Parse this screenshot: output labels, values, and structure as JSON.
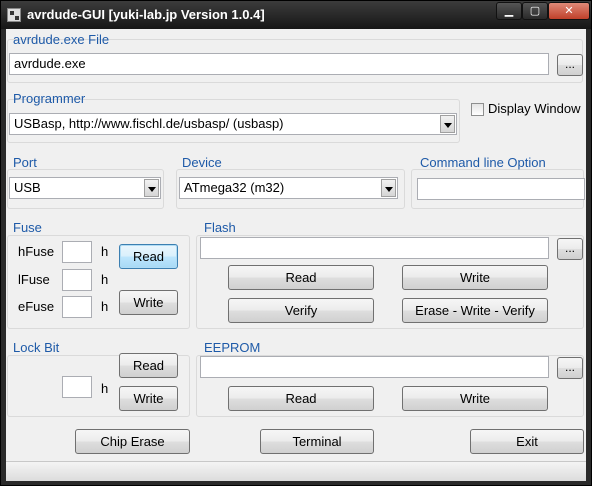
{
  "window": {
    "title": "avrdude-GUI [yuki-lab.jp Version 1.0.4]",
    "minimize_glyph": "▁",
    "maximize_glyph": "▢",
    "close_glyph": "✕"
  },
  "avrdude_file": {
    "legend": "avrdude.exe File",
    "value": "avrdude.exe",
    "browse_label": "..."
  },
  "programmer": {
    "legend": "Programmer",
    "selected": "USBasp, http://www.fischl.de/usbasp/ (usbasp)",
    "display_window_label": "Display Window",
    "display_window_checked": false
  },
  "port": {
    "legend": "Port",
    "selected": "USB"
  },
  "device": {
    "legend": "Device",
    "selected": "ATmega32 (m32)"
  },
  "command_line": {
    "legend": "Command line Option",
    "value": ""
  },
  "fuse": {
    "legend": "Fuse",
    "hfuse_label": "hFuse",
    "lfuse_label": "lFuse",
    "efuse_label": "eFuse",
    "unit": "h",
    "hfuse_value": "",
    "lfuse_value": "",
    "efuse_value": "",
    "read_label": "Read",
    "write_label": "Write"
  },
  "flash": {
    "legend": "Flash",
    "file_value": "",
    "browse_label": "...",
    "read_label": "Read",
    "write_label": "Write",
    "verify_label": "Verify",
    "erase_write_verify_label": "Erase - Write - Verify"
  },
  "lock_bit": {
    "legend": "Lock Bit",
    "unit": "h",
    "value": "",
    "read_label": "Read",
    "write_label": "Write"
  },
  "eeprom": {
    "legend": "EEPROM",
    "file_value": "",
    "browse_label": "...",
    "read_label": "Read",
    "write_label": "Write"
  },
  "bottom": {
    "chip_erase_label": "Chip Erase",
    "terminal_label": "Terminal",
    "exit_label": "Exit"
  }
}
